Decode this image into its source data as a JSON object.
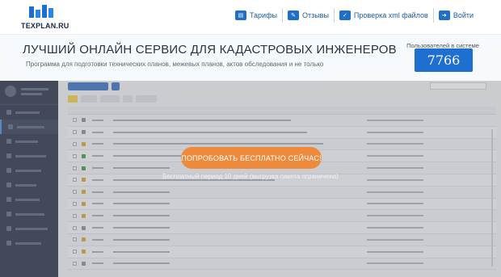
{
  "header": {
    "logo_text": "TEXPLAN.RU",
    "nav": [
      {
        "label": "Тарифы",
        "icon": "tariffs-icon"
      },
      {
        "label": "Отзывы",
        "icon": "reviews-icon"
      },
      {
        "label": "Проверка xml файлов",
        "icon": "xml-check-icon"
      },
      {
        "label": "Войти",
        "icon": "login-icon"
      }
    ]
  },
  "hero": {
    "title": "ЛУЧШИЙ ОНЛАЙН СЕРВИС ДЛЯ КАДАСТРОВЫХ ИНЖЕНЕРОВ",
    "subtitle": "Программа для подготовки технических планов, межевых планов, актов обследования и не только",
    "users_label": "Пользователей в системе",
    "users_count": "7766"
  },
  "cta": {
    "button_label": "ПОПРОБОВАТЬ БЕСПЛАТНО СЕЙЧАС!",
    "trial_text": "Бесплатный период 10 дней (выгрузка пакета ограничена)"
  },
  "colors": {
    "brand_blue": "#1f6fd0",
    "cta_orange": "#ee8a3c"
  }
}
